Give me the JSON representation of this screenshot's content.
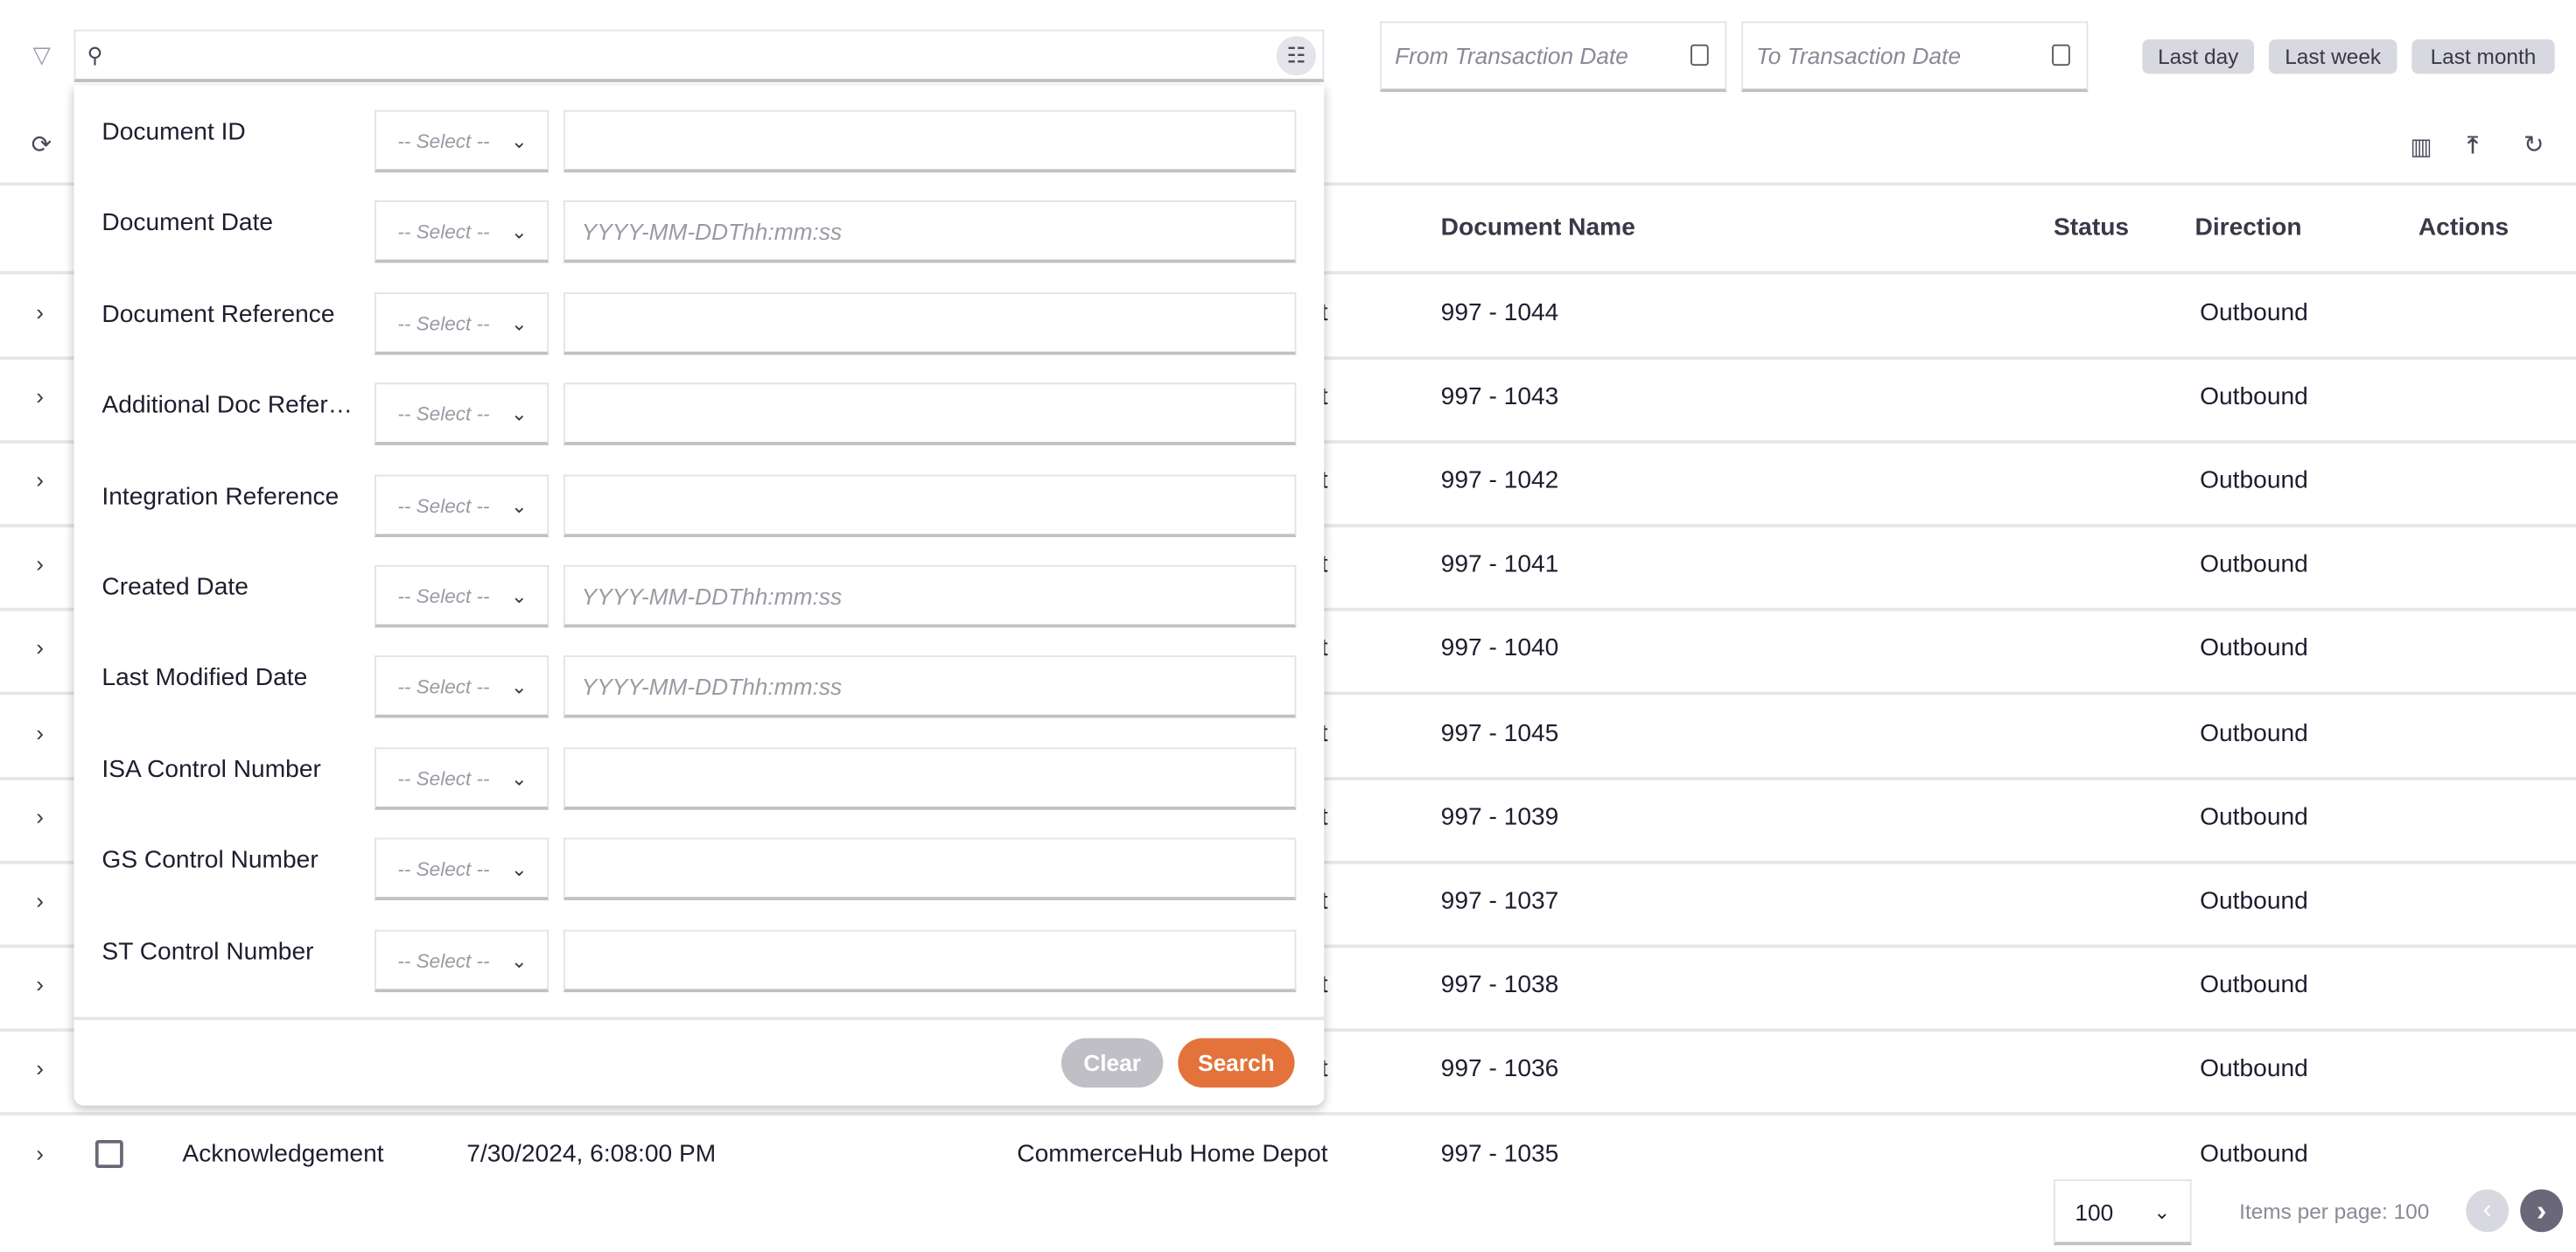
{
  "toolbar": {
    "search_placeholder": "",
    "from_date_placeholder": "From Transaction Date",
    "to_date_placeholder": "To Transaction Date",
    "quick_ranges": [
      "Last day",
      "Last week",
      "Last month"
    ]
  },
  "table": {
    "headers": {
      "document_name": "Document Name",
      "status": "Status",
      "direction": "Direction",
      "actions": "Actions"
    },
    "rows": [
      {
        "partner": "CommerceHub Home Depot",
        "document_name": "997 - 1044",
        "direction": "Outbound"
      },
      {
        "partner": "CommerceHub Home Depot",
        "document_name": "997 - 1043",
        "direction": "Outbound"
      },
      {
        "partner": "CommerceHub Home Depot",
        "document_name": "997 - 1042",
        "direction": "Outbound"
      },
      {
        "partner": "CommerceHub Home Depot",
        "document_name": "997 - 1041",
        "direction": "Outbound"
      },
      {
        "partner": "CommerceHub Home Depot",
        "document_name": "997 - 1040",
        "direction": "Outbound"
      },
      {
        "partner": "CommerceHub Home Depot",
        "document_name": "997 - 1045",
        "direction": "Outbound"
      },
      {
        "partner": "CommerceHub Home Depot",
        "document_name": "997 - 1039",
        "direction": "Outbound"
      },
      {
        "partner": "CommerceHub Home Depot",
        "document_name": "997 - 1037",
        "direction": "Outbound"
      },
      {
        "partner": "CommerceHub Home Depot",
        "document_name": "997 - 1038",
        "direction": "Outbound"
      },
      {
        "partner": "CommerceHub Home Depot",
        "document_name": "997 - 1036",
        "direction": "Outbound"
      }
    ],
    "last_row": {
      "type": "Acknowledgement",
      "date": "7/30/2024, 6:08:00 PM",
      "partner": "CommerceHub Home Depot",
      "document_name": "997 - 1035",
      "direction": "Outbound"
    }
  },
  "filter_panel": {
    "select_placeholder": "-- Select --",
    "date_placeholder": "YYYY-MM-DDThh:mm:ss",
    "fields": [
      {
        "label": "Document ID",
        "placeholder": ""
      },
      {
        "label": "Document Date",
        "placeholder": "YYYY-MM-DDThh:mm:ss"
      },
      {
        "label": "Document Reference",
        "placeholder": ""
      },
      {
        "label": "Additional Doc Reference",
        "placeholder": ""
      },
      {
        "label": "Integration Reference",
        "placeholder": ""
      },
      {
        "label": "Created Date",
        "placeholder": "YYYY-MM-DDThh:mm:ss"
      },
      {
        "label": "Last Modified Date",
        "placeholder": "YYYY-MM-DDThh:mm:ss"
      },
      {
        "label": "ISA Control Number",
        "placeholder": ""
      },
      {
        "label": "GS Control Number",
        "placeholder": ""
      },
      {
        "label": "ST Control Number",
        "placeholder": ""
      }
    ],
    "clear_label": "Clear",
    "search_label": "Search"
  },
  "pagination": {
    "page_size": "100",
    "items_per_page_label": "Items per page: 100"
  },
  "colors": {
    "accent": "#e3733b",
    "clear_button": "#bfbfc5",
    "chip": "#d8d8e0"
  }
}
